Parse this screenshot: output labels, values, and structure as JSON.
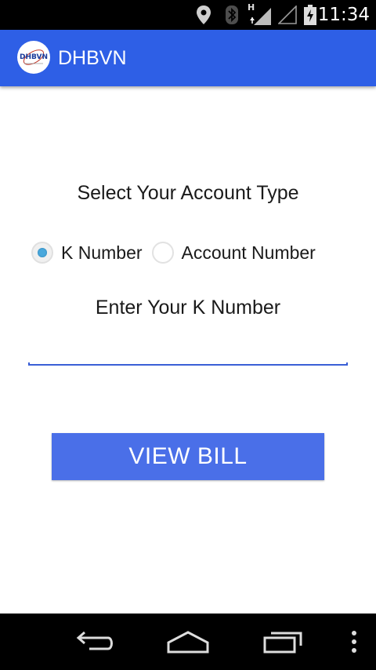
{
  "status_bar": {
    "time": "11:34",
    "network_type": "H",
    "icons": [
      "location-icon",
      "bluetooth-icon",
      "signal-icon",
      "battery-charging-icon"
    ]
  },
  "app_bar": {
    "title": "DHBVN",
    "logo_text": "DHBVN",
    "color": "#2e5fe6"
  },
  "form": {
    "heading": "Select Your Account Type",
    "options": [
      {
        "label": "K Number",
        "selected": true
      },
      {
        "label": "Account Number",
        "selected": false
      }
    ],
    "enter_label": "Enter Your K Number",
    "input_value": "",
    "button_label": "VIEW BILL",
    "button_color": "#4a6fe8"
  },
  "nav_bar": {
    "buttons": [
      "back-icon",
      "home-icon",
      "recents-icon",
      "overflow-menu-icon"
    ]
  }
}
